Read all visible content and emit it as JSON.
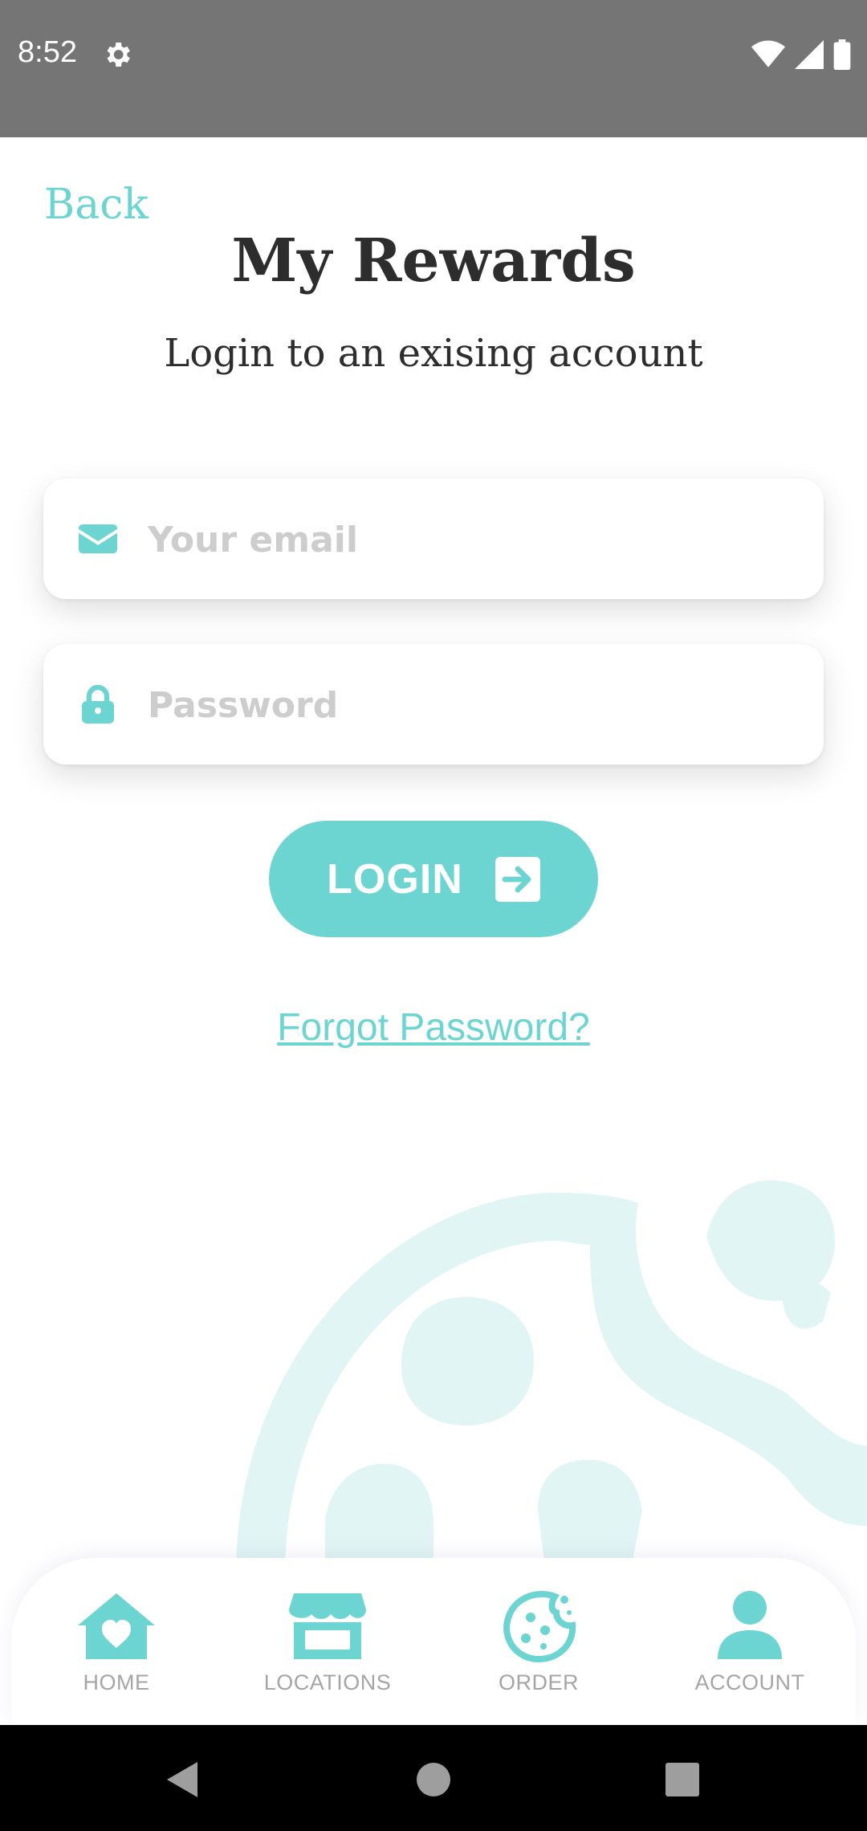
{
  "status_bar": {
    "time": "8:52",
    "icons": [
      "settings-icon",
      "wifi-icon",
      "signal-icon",
      "battery-icon"
    ]
  },
  "header": {
    "back_label": "Back",
    "title": "My Rewards",
    "subtitle": "Login to an exising account"
  },
  "form": {
    "email": {
      "placeholder": "Your email",
      "value": "",
      "icon": "envelope-icon"
    },
    "password": {
      "placeholder": "Password",
      "value": "",
      "icon": "lock-icon"
    },
    "login_label": "LOGIN",
    "login_icon": "arrow-right-square-icon",
    "forgot_label": "Forgot Password?"
  },
  "bottom_nav": {
    "items": [
      {
        "label": "HOME",
        "icon": "home-heart-icon"
      },
      {
        "label": "LOCATIONS",
        "icon": "store-icon"
      },
      {
        "label": "ORDER",
        "icon": "cookie-icon"
      },
      {
        "label": "ACCOUNT",
        "icon": "user-icon"
      }
    ]
  },
  "colors": {
    "accent": "#6dd5d1",
    "accent_light": "#e0f5f4",
    "text_dark": "#2d2d2d",
    "placeholder": "#cdcdcd",
    "status_bar": "#757575"
  }
}
